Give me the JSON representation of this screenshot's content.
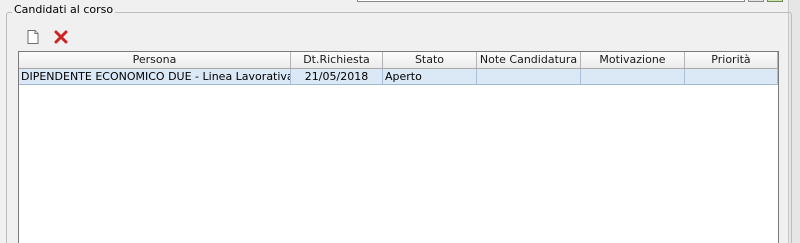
{
  "group": {
    "title": "Candidati al corso"
  },
  "toolbar": {
    "new_icon": "new-document-icon",
    "delete_icon": "delete-x-icon",
    "delete_color": "#cc2222"
  },
  "grid": {
    "columns": [
      "Persona",
      "Dt.Richiesta",
      "Stato",
      "Note Candidatura",
      "Motivazione",
      "Priorità"
    ],
    "rows": [
      {
        "persona": "DIPENDENTE ECONOMICO DUE - Linea Lavorativa",
        "dt_richiesta": "21/05/2018",
        "stato": "Aperto",
        "note_candidatura": "",
        "motivazione": "",
        "priorita": ""
      }
    ],
    "selected_row_color": "#dbe8f6"
  }
}
